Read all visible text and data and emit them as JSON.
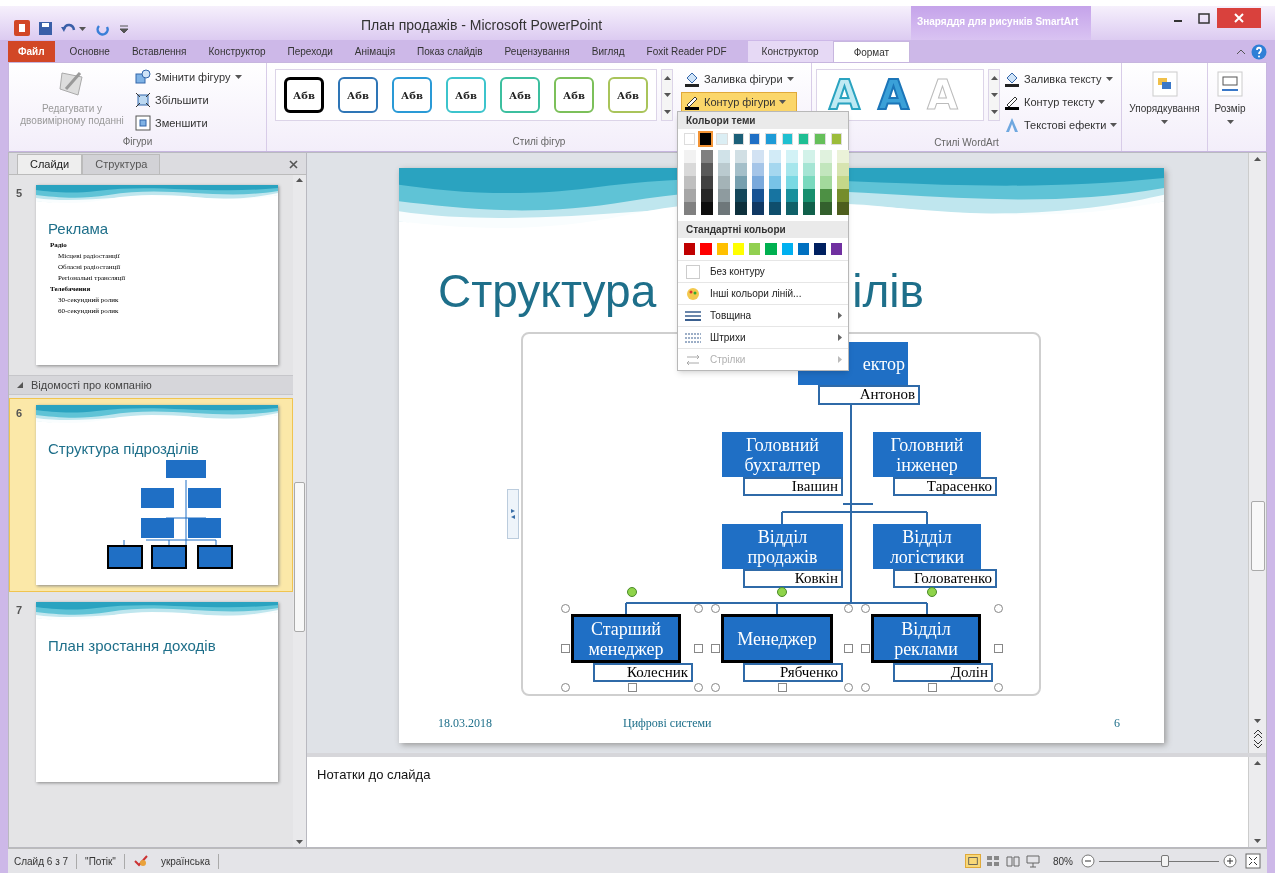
{
  "window": {
    "title": "План продажів - Microsoft PowerPoint",
    "context_group": "Знаряддя для рисунків SmartArt"
  },
  "ribbon_tabs": [
    {
      "label": "Файл",
      "kind": "file",
      "selected": false
    },
    {
      "label": "Основне",
      "kind": "normal",
      "selected": false
    },
    {
      "label": "Вставлення",
      "kind": "normal",
      "selected": false
    },
    {
      "label": "Конструктор",
      "kind": "normal",
      "selected": false
    },
    {
      "label": "Переходи",
      "kind": "normal",
      "selected": false
    },
    {
      "label": "Анімація",
      "kind": "normal",
      "selected": false
    },
    {
      "label": "Показ слайдів",
      "kind": "normal",
      "selected": false
    },
    {
      "label": "Рецензування",
      "kind": "normal",
      "selected": false
    },
    {
      "label": "Вигляд",
      "kind": "normal",
      "selected": false
    },
    {
      "label": "Foxit Reader PDF",
      "kind": "normal",
      "selected": false
    },
    {
      "label": "Конструктор",
      "kind": "context",
      "selected": false
    },
    {
      "label": "Формат",
      "kind": "context",
      "selected": true
    }
  ],
  "ribbon": {
    "shapes": {
      "title": "Фігури",
      "edit_2d": {
        "label": "Редагувати у двовимірному поданні",
        "disabled": true
      },
      "commands": [
        {
          "label": "Змінити фігуру",
          "kind": "change"
        },
        {
          "label": "Збільшити",
          "kind": "larger"
        },
        {
          "label": "Зменшити",
          "kind": "smaller"
        }
      ]
    },
    "shape_styles": {
      "title": "Стилі фігур",
      "styles": [
        {
          "label": "Абв",
          "color": "#000000",
          "selected": true
        },
        {
          "label": "Абв",
          "color": "#2e75b6",
          "selected": false
        },
        {
          "label": "Абв",
          "color": "#2a9ad6",
          "selected": false
        },
        {
          "label": "Абв",
          "color": "#3cc4cc",
          "selected": false
        },
        {
          "label": "Абв",
          "color": "#3cbf9f",
          "selected": false
        },
        {
          "label": "Абв",
          "color": "#7cc05a",
          "selected": false
        },
        {
          "label": "Абв",
          "color": "#a9c45a",
          "selected": false
        }
      ],
      "commands": [
        {
          "label": "Заливка фігури",
          "kind": "fill",
          "active": false
        },
        {
          "label": "Контур фігури",
          "kind": "outline",
          "active": true
        }
      ]
    },
    "wordart": {
      "title": "Стилі WordArt",
      "samples": [
        {
          "label": "A",
          "kind": "light"
        },
        {
          "label": "A",
          "kind": "blue"
        },
        {
          "label": "A",
          "kind": "faint"
        }
      ],
      "commands": [
        {
          "label": "Заливка тексту",
          "kind": "fill"
        },
        {
          "label": "Контур тексту",
          "kind": "outline"
        },
        {
          "label": "Текстові ефекти",
          "kind": "effects"
        }
      ]
    },
    "arrange": "Упорядкування",
    "size": "Розмір"
  },
  "outline_menu": {
    "theme_title": "Кольори теми",
    "theme_colors": [
      {
        "color": "#ffffff",
        "selected": false
      },
      {
        "color": "#000000",
        "selected": true
      },
      {
        "color": "#dbeef4",
        "selected": false
      },
      {
        "color": "#1b5f78",
        "selected": false
      },
      {
        "color": "#1f6fc5",
        "selected": false
      },
      {
        "color": "#1e9bd7",
        "selected": false
      },
      {
        "color": "#20c0d0",
        "selected": false
      },
      {
        "color": "#1fbf93",
        "selected": false
      },
      {
        "color": "#66c05a",
        "selected": false
      },
      {
        "color": "#9cbc3a",
        "selected": false
      }
    ],
    "standard_title": "Стандартні кольори",
    "standard_colors": [
      {
        "color": "#c00000"
      },
      {
        "color": "#ff0000"
      },
      {
        "color": "#ffc000"
      },
      {
        "color": "#ffff00"
      },
      {
        "color": "#92d050"
      },
      {
        "color": "#00b050"
      },
      {
        "color": "#00b0f0"
      },
      {
        "color": "#0070c0"
      },
      {
        "color": "#002060"
      },
      {
        "color": "#7030a0"
      }
    ],
    "items": [
      {
        "label": "Без контуру",
        "kind": "none",
        "disabled": false,
        "submenu": false
      },
      {
        "label": "Інші кольори ліній...",
        "kind": "more",
        "disabled": false,
        "submenu": false
      },
      {
        "label": "Товщина",
        "kind": "weight",
        "disabled": false,
        "submenu": true
      },
      {
        "label": "Штрихи",
        "kind": "dashes",
        "disabled": false,
        "submenu": true
      },
      {
        "label": "Стрілки",
        "kind": "arrows",
        "disabled": true,
        "submenu": true
      }
    ]
  },
  "slides_pane": {
    "tabs": [
      {
        "label": "Слайди",
        "selected": true
      },
      {
        "label": "Структура",
        "selected": false
      }
    ],
    "items": [
      {
        "kind": "slide",
        "number": "5",
        "title": "Реклама",
        "selected": false,
        "bullets": [
          {
            "text": "Радіо",
            "children": [
              {
                "text": "Місцеві радіостанції"
              },
              {
                "text": "Обласні радіостанції"
              },
              {
                "text": "Регіональні трансляції"
              }
            ]
          },
          {
            "text": "Телебачення",
            "children": [
              {
                "text": "30-секундний ролик"
              },
              {
                "text": "60-секундний ролик"
              }
            ]
          }
        ]
      },
      {
        "kind": "section",
        "label": "Відомості про компанію"
      },
      {
        "kind": "slide",
        "number": "6",
        "title": "Структура підрозділів",
        "selected": true,
        "org_chart": true
      },
      {
        "kind": "slide",
        "number": "7",
        "title": "План зростання доходів",
        "selected": false
      }
    ]
  },
  "slide": {
    "title_parts": [
      "Структура",
      "ілів"
    ],
    "nodes": [
      {
        "label": "ектор",
        "name": "Антонов",
        "selected": false
      },
      {
        "label": "Головний бухгалтер",
        "name": "Івашин",
        "selected": false
      },
      {
        "label": "Головний інженер",
        "name": "Тарасенко",
        "selected": false
      },
      {
        "label": "Відділ продажів",
        "name": "Ковкін",
        "selected": false
      },
      {
        "label": "Відділ логістики",
        "name": "Головатенко",
        "selected": false
      },
      {
        "label": "Старший менеджер",
        "name": "Колесник",
        "selected": true
      },
      {
        "label": "Менеджер",
        "name": "Рябченко",
        "selected": true
      },
      {
        "label": "Відділ реклами",
        "name": "Долін",
        "selected": true
      }
    ],
    "footer": {
      "date": "18.03.2018",
      "text": "Цифрові системи",
      "number": "6"
    }
  },
  "notes": {
    "placeholder": "Нотатки до слайда"
  },
  "status_bar": {
    "slide": "Слайд 6 з 7",
    "theme": "\"Потік\"",
    "language": "українська",
    "zoom": "80%",
    "zoom_slider": {
      "level": 0.55
    }
  }
}
